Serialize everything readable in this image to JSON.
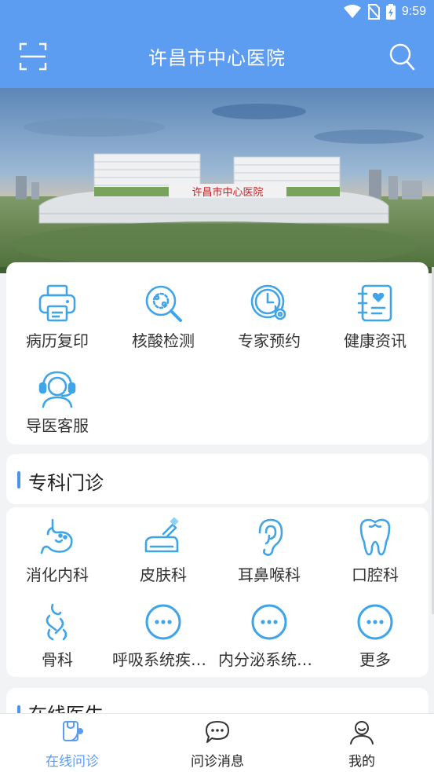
{
  "status_bar": {
    "time": "9:59"
  },
  "header": {
    "title": "许昌市中心医院"
  },
  "banner": {
    "sign_text": "许昌市中心医院"
  },
  "services": [
    {
      "label": "病历复印",
      "icon": "printer-icon"
    },
    {
      "label": "核酸检测",
      "icon": "virus-search-icon"
    },
    {
      "label": "专家预约",
      "icon": "clock-stethoscope-icon"
    },
    {
      "label": "健康资讯",
      "icon": "health-notebook-icon"
    },
    {
      "label": "导医客服",
      "icon": "headset-agent-icon"
    }
  ],
  "specialty": {
    "title": "专科门诊",
    "items": [
      {
        "label": "消化内科",
        "icon": "stomach-icon"
      },
      {
        "label": "皮肤科",
        "icon": "skin-cream-icon"
      },
      {
        "label": "耳鼻喉科",
        "icon": "ear-icon"
      },
      {
        "label": "口腔科",
        "icon": "tooth-icon"
      },
      {
        "label": "骨科",
        "icon": "bone-joint-icon"
      },
      {
        "label": "呼吸系统疾病...",
        "icon": "more-dots-icon"
      },
      {
        "label": "内分泌系统疾...",
        "icon": "more-dots-icon"
      },
      {
        "label": "更多",
        "icon": "more-dots-icon"
      }
    ]
  },
  "online_doctors": {
    "title": "在线医生"
  },
  "tabs": [
    {
      "label": "在线问诊",
      "icon": "consult-icon",
      "active": true
    },
    {
      "label": "问诊消息",
      "icon": "chat-bubble-icon",
      "active": false
    },
    {
      "label": "我的",
      "icon": "profile-icon",
      "active": false
    }
  ],
  "colors": {
    "primary": "#5c9df2",
    "icon_blue": "#3fa4e8",
    "accent_line": "#4e93ee"
  }
}
